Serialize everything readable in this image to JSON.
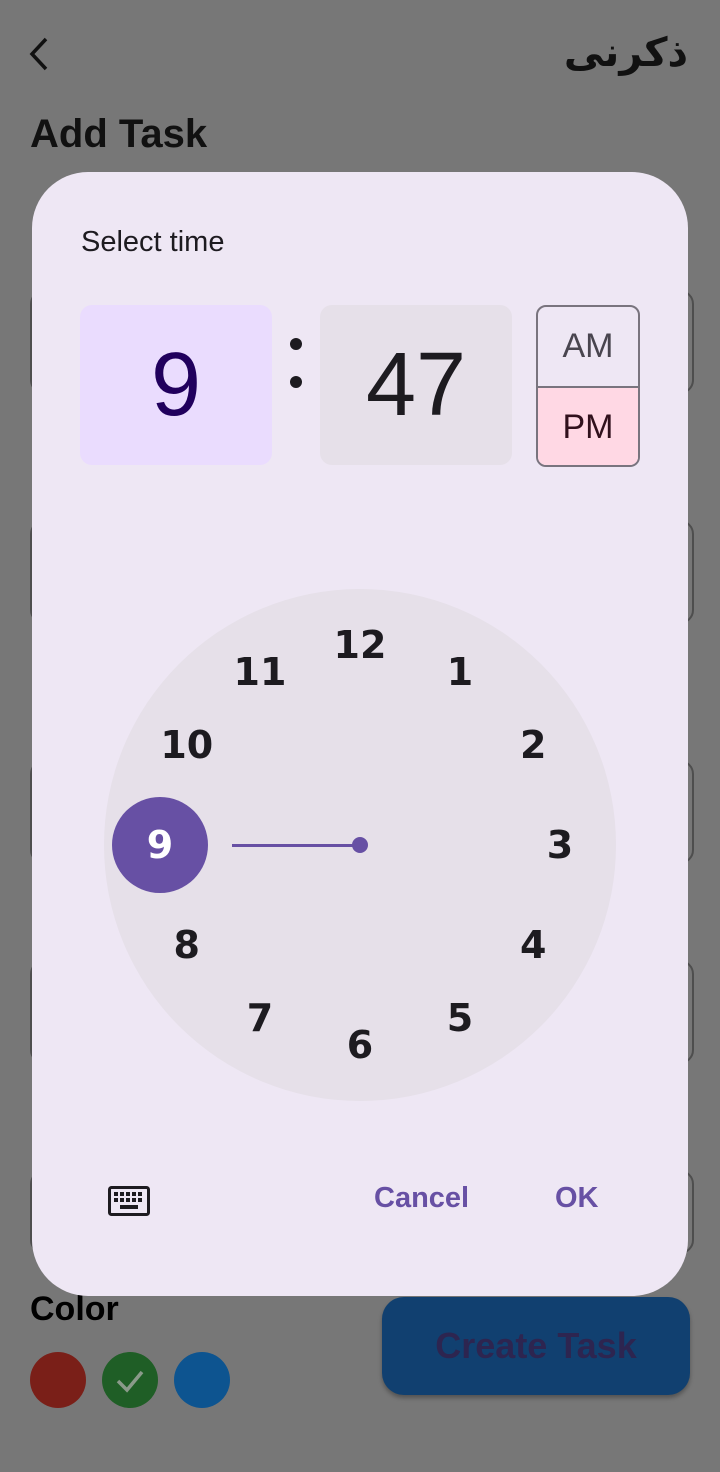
{
  "app": {
    "title": "ذكرنى",
    "back_icon": "chevron-left-icon"
  },
  "page": {
    "heading": "Add Task",
    "color_label": "Color",
    "create_button": "Create Task"
  },
  "colors": [
    {
      "name": "red",
      "hex": "#7a1f18",
      "selected": false
    },
    {
      "name": "green",
      "hex": "#1f5e26",
      "selected": true
    },
    {
      "name": "blue",
      "hex": "#0d5490",
      "selected": false
    }
  ],
  "dialog": {
    "title": "Select time",
    "hour": "9",
    "minute": "47",
    "am": "AM",
    "pm": "PM",
    "period_selected": "PM",
    "dial_numbers": [
      "12",
      "1",
      "2",
      "3",
      "4",
      "5",
      "6",
      "7",
      "8",
      "9",
      "10",
      "11"
    ],
    "selected_hour": "9",
    "keyboard_icon": "keyboard-icon",
    "cancel": "Cancel",
    "ok": "OK",
    "accent": "#6750a4"
  }
}
